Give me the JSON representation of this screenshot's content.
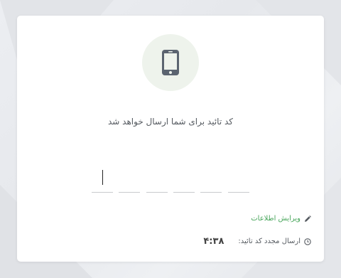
{
  "verification": {
    "icon": "mobile-phone-icon",
    "message": "کد تائید برای شما ارسال خواهد شد",
    "otp": {
      "length": 6,
      "values": [
        "",
        "",
        "",
        "",
        "",
        ""
      ],
      "active_index": 0
    },
    "edit_info_label": "ویرایش اطلاعات",
    "edit_icon": "pencil-icon",
    "resend_label": "ارسال مجدد کد تائید:",
    "resend_icon": "clock-icon",
    "timer": "۴:۳۸"
  },
  "colors": {
    "accent_green": "#47a55a",
    "icon_circle_bg": "#eef3ec",
    "phone_icon": "#5b6470",
    "text": "#555a60",
    "page_bg": "#e9ebef"
  }
}
